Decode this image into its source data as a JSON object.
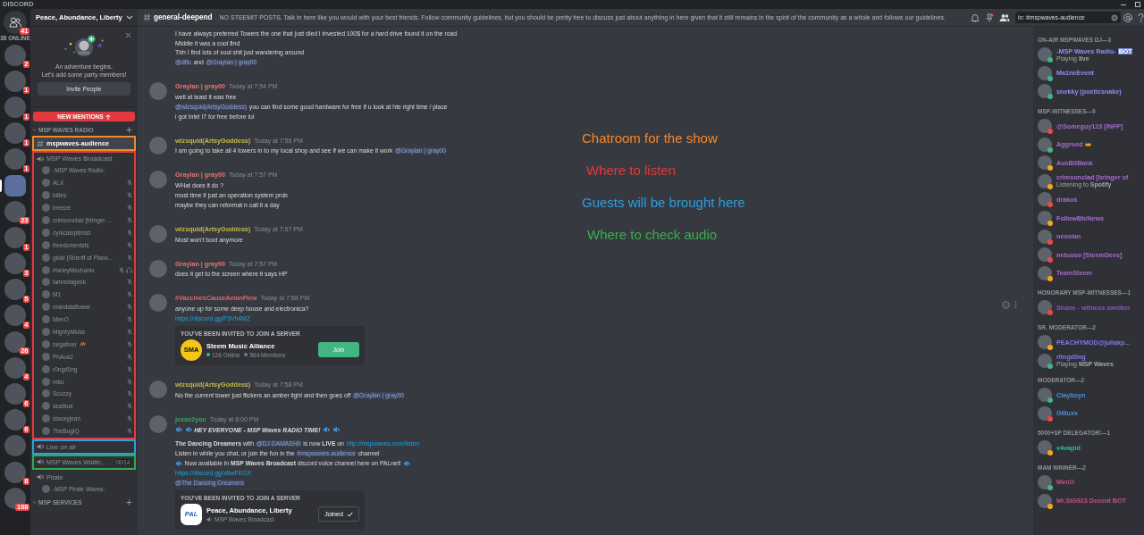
{
  "app_title": "DISCORD",
  "servers": {
    "friends_badge": "41",
    "online_count": "38 ONLINE",
    "items": [
      {
        "badge": "2",
        "selected": false
      },
      {
        "badge": "1",
        "selected": false
      },
      {
        "badge": "1",
        "selected": false
      },
      {
        "badge": "1",
        "selected": false
      },
      {
        "badge": "1",
        "selected": false
      },
      {
        "selected": true
      },
      {
        "badge": "23",
        "selected": false
      },
      {
        "badge": "1",
        "selected": false
      },
      {
        "badge": "3",
        "selected": false
      },
      {
        "badge": "5",
        "selected": false
      },
      {
        "badge": "4",
        "selected": false
      },
      {
        "badge": "26",
        "selected": false
      },
      {
        "badge": "4",
        "selected": false
      },
      {
        "badge": "6",
        "selected": false
      },
      {
        "badge": "6",
        "selected": false
      },
      {
        "selected": false
      },
      {
        "badge": "8",
        "selected": false
      },
      {
        "badge": "108",
        "selected": false
      }
    ]
  },
  "sidebar": {
    "server_name": "Peace, Abundance, Liberty",
    "welcome": {
      "title": "An adventure begins.",
      "subtitle": "Let's add some party members!",
      "button": "Invite People"
    },
    "new_mentions": "NEW MENTIONS",
    "categories": [
      {
        "name": "MSP WAVES RADIO",
        "channels": [
          {
            "kind": "text",
            "name": "mspwaves-audience",
            "selected": true,
            "color": "#f08a2c"
          },
          {
            "kind": "voice",
            "name": "MSP Waves Broadcast",
            "selected": false,
            "color": "#e33b3b",
            "users": [
              {
                "name": "-MSP Waves Radio-",
                "muted": false,
                "deafened": false,
                "emoji": false
              },
              {
                "name": "ALX",
                "muted": true,
                "deafened": false,
                "emoji": false
              },
              {
                "name": "bities",
                "muted": true,
                "deafened": false,
                "emoji": false
              },
              {
                "name": "breeze",
                "muted": true,
                "deafened": false,
                "emoji": false
              },
              {
                "name": "crimsonclad [bringer ...",
                "muted": true,
                "deafened": false,
                "emoji": false
              },
              {
                "name": "cynicaloptimist",
                "muted": true,
                "deafened": false,
                "emoji": false
              },
              {
                "name": "freedomexists",
                "muted": true,
                "deafened": false,
                "emoji": false
              },
              {
                "name": "globi (Sheriff of Plank...",
                "muted": true,
                "deafened": false,
                "emoji": false
              },
              {
                "name": "HarleyMechanix",
                "muted": true,
                "deafened": true,
                "emoji": false
              },
              {
                "name": "iamnotageek",
                "muted": true,
                "deafened": false,
                "emoji": false
              },
              {
                "name": "M1",
                "muted": true,
                "deafened": false,
                "emoji": false
              },
              {
                "name": "mandalaflower",
                "muted": true,
                "deafened": false,
                "emoji": false
              },
              {
                "name": "MenO",
                "muted": true,
                "deafened": false,
                "emoji": false
              },
              {
                "name": "MightyMicke",
                "muted": true,
                "deafened": false,
                "emoji": false
              },
              {
                "name": "negativer",
                "muted": true,
                "deafened": false,
                "emoji": true
              },
              {
                "name": "PhAus2",
                "muted": true,
                "deafened": false,
                "emoji": false
              },
              {
                "name": "r0ngd0ng",
                "muted": true,
                "deafened": false,
                "emoji": false
              },
              {
                "name": "reko",
                "muted": true,
                "deafened": false,
                "emoji": false
              },
              {
                "name": "Scuzzy",
                "muted": true,
                "deafened": false,
                "emoji": false
              },
              {
                "name": "seablue",
                "muted": true,
                "deafened": false,
                "emoji": false
              },
              {
                "name": "staceyjean",
                "muted": true,
                "deafened": false,
                "emoji": false
              },
              {
                "name": "TheBugIQ",
                "muted": true,
                "deafened": false,
                "emoji": false
              }
            ]
          },
          {
            "kind": "voice",
            "name": "Live on air",
            "selected": false,
            "color": "#2b9fe2"
          },
          {
            "kind": "voice",
            "name": "MSP Waves Waitin...",
            "limit": "00/14",
            "selected": false,
            "color": "#33aa4f"
          },
          {
            "kind": "voice",
            "name": "Pirate",
            "selected": false,
            "users": [
              {
                "name": "-MSP Pirate Waves-",
                "muted": false,
                "deafened": false,
                "emoji": false
              }
            ]
          }
        ]
      },
      {
        "name": "MSP SERVICES"
      }
    ]
  },
  "header": {
    "channel": "general-deepend",
    "topic": "NO STEEMIT POSTS. Talk in here like you would with your best friends. Follow community guidelines, but you should be pretty free to discuss just about anything in here given that it still remains in the spirit of the community as a whole and follows our guidelines.",
    "search_value": "in: #mspwaves-audience"
  },
  "messages": [
    {
      "show_actions": false,
      "paragraphs": [
        [
          [
            {
              "kind": "text",
              "text": "I have always preferred Towers the one that just died I invested 100$ for a hard drive found it on the road"
            }
          ],
          [
            {
              "kind": "text",
              "text": "Middle it was a cool find"
            }
          ],
          [
            {
              "kind": "text",
              "text": "Tbh I find lots of xool shit just wandering around"
            }
          ],
          [
            {
              "kind": "mention",
              "text": "@dflo"
            },
            {
              "kind": "text",
              "text": "and"
            },
            {
              "kind": "mention",
              "text": "@Graylan | gray00"
            }
          ]
        ]
      ]
    },
    {
      "author": "Graylan | gray00",
      "color": "#e8776b",
      "time": "Today at 7:54 PM",
      "show_actions": false,
      "paragraphs": [
        [
          [
            {
              "kind": "text",
              "text": "well at least it was free"
            }
          ],
          [
            {
              "kind": "mention",
              "text": "@wizsquid(ArtsyGoddess)"
            },
            {
              "kind": "text",
              "text": "you can find some good hardware for free if u look at hte right time / place"
            }
          ],
          [
            {
              "kind": "text",
              "text": "i got Intel I7 for free before lol"
            }
          ]
        ]
      ]
    },
    {
      "author": "wizsquid(ArtsyGoddess)",
      "color": "#c4b94a",
      "time": "Today at 7:56 PM",
      "show_actions": false,
      "paragraphs": [
        [
          [
            {
              "kind": "text",
              "text": "I am going to take all 4 towers in to my local shop and see if we can make it work"
            },
            {
              "kind": "mention",
              "text": "@Graylan | gray00"
            }
          ]
        ]
      ]
    },
    {
      "author": "Graylan | gray00",
      "color": "#e8776b",
      "time": "Today at 7:57 PM",
      "show_actions": false,
      "paragraphs": [
        [
          [
            {
              "kind": "text",
              "text": "WHat does it do ?"
            }
          ],
          [
            {
              "kind": "text",
              "text": "most time it just an operation system prob"
            }
          ],
          [
            {
              "kind": "text",
              "text": "maybe they can reformat n call it a day"
            }
          ]
        ]
      ]
    },
    {
      "author": "wizsquid(ArtsyGoddess)",
      "color": "#c4b94a",
      "time": "Today at 7:57 PM",
      "show_actions": false,
      "paragraphs": [
        [
          [
            {
              "kind": "text",
              "text": "Most won't boot anymore"
            }
          ]
        ]
      ]
    },
    {
      "author": "Graylan | gray00",
      "color": "#e8776b",
      "time": "Today at 7:57 PM",
      "show_actions": false,
      "paragraphs": [
        [
          [
            {
              "kind": "text",
              "text": "does it get to the screen where it says HP"
            }
          ]
        ]
      ]
    },
    {
      "author": "#VaccinesCauseAvianFlew",
      "color": "#e0656e",
      "time": "Today at 7:58 PM",
      "show_actions": true,
      "paragraphs": [
        [
          [
            {
              "kind": "text",
              "text": "anyone up for some deep house and electronica?"
            }
          ],
          [
            {
              "kind": "link",
              "text": "https://discord.gg/P3Vh4MZ"
            }
          ]
        ]
      ],
      "invite": {
        "heading": "YOU'VE BEEN INVITED TO JOIN A SERVER",
        "logo": "SMA",
        "server": "Steem Music Alliance",
        "online": "126 Online",
        "members": "564 Members",
        "button": "Join",
        "joined": false
      }
    },
    {
      "author": "wizsquid(ArtsyGoddess)",
      "color": "#c4b94a",
      "time": "Today at 7:58 PM",
      "show_actions": false,
      "paragraphs": [
        [
          [
            {
              "kind": "text",
              "text": "No the current tower just flickers an amber light and then goes off"
            },
            {
              "kind": "mention",
              "text": "@Graylan | gray00"
            }
          ]
        ]
      ]
    },
    {
      "author": "jesse2you",
      "color": "#3aa55d",
      "time": "Today at 8:00 PM",
      "show_actions": false,
      "paragraphs": [
        [
          [
            {
              "kind": "emoji"
            },
            {
              "kind": "emoji"
            },
            {
              "kind": "emphasis",
              "text": "HEY EVERYONE - MSP Waves RADIO TIME!"
            },
            {
              "kind": "emoji"
            },
            {
              "kind": "emoji"
            }
          ]
        ],
        [
          [
            {
              "kind": "text",
              "text": "**The Dancing Dreamers** with"
            },
            {
              "kind": "mention",
              "text": "@DJ DAMASHII"
            },
            {
              "kind": "text",
              "text": "is now **LIVE** on"
            },
            {
              "kind": "link",
              "text": "http://mspwaves.com/listen"
            }
          ],
          [
            {
              "kind": "text",
              "text": "Listen in while you chat, or join the fun in the"
            },
            {
              "kind": "channel",
              "text": "#mspwaves-audience"
            },
            {
              "kind": "text",
              "text": "channel"
            }
          ],
          [
            {
              "kind": "emoji"
            },
            {
              "kind": "text",
              "text": "Now available in **MSP Waves Broadcast** discord voice channel here on PALnet!"
            },
            {
              "kind": "emoji"
            }
          ],
          [
            {
              "kind": "link",
              "text": "https://discord.gg/xBwFKGX"
            }
          ],
          [
            {
              "kind": "mention",
              "text": "@The Dancing Dreamers"
            }
          ]
        ]
      ],
      "invite": {
        "heading": "YOU'VE BEEN INVITED TO JOIN A SERVER",
        "logo": "PAL",
        "server": "Peace, Abundance, Liberty",
        "channel": "MSP Waves Broadcast",
        "button": "Joined",
        "joined": true
      }
    }
  ],
  "annotations": [
    {
      "text": "Chatroom for the show",
      "color": "#f5872b"
    },
    {
      "text": "Where to listen",
      "color": "#e93838"
    },
    {
      "text": "Guests will be brought here",
      "color": "#2a9fe0"
    },
    {
      "text": "Where to check audio",
      "color": "#36b24a"
    }
  ],
  "members": {
    "groups": [
      {
        "title": "ON-AIR MSPWAVES DJ—3",
        "color": "#8e8ef5",
        "members": [
          {
            "name": "-MSP Waves Radio-",
            "color": "#43b581",
            "tag": "BOT",
            "activity": "Playing **live**",
            "crown": false
          },
          {
            "name": "Ma1neEvent",
            "color": "#43b581",
            "crown": false
          },
          {
            "name": "snekky (poeticsnake)",
            "color": "#43b581",
            "crown": false
          }
        ]
      },
      {
        "title": "MSP-WITNESSES—9",
        "color": "#a66bd0",
        "members": [
          {
            "name": "@Someguy123 [INFP]",
            "color": "#f04747",
            "crown": false
          },
          {
            "name": "Aggroed",
            "color": "#43b581",
            "crown": true
          },
          {
            "name": "AusBitBank",
            "color": "#faa61a",
            "crown": false
          },
          {
            "name": "crimsonclad [bringer of",
            "color": "#faa61a",
            "activity": "Listening to **Spotify**",
            "crown": false
          },
          {
            "name": "drakos",
            "color": "#f04747",
            "crown": false
          },
          {
            "name": "FollowBtcNews",
            "color": "#faa61a",
            "crown": false
          },
          {
            "name": "neoxian",
            "color": "#f04747",
            "crown": false
          },
          {
            "name": "netuoso [SteemDevs]",
            "color": "#f04747",
            "crown": false
          },
          {
            "name": "TeamSteem",
            "color": "#faa61a",
            "crown": false
          }
        ]
      },
      {
        "title": "HONORARY MSP-WITNESSES—1",
        "color": "#8a52c8",
        "members": [
          {
            "name": "Shane - witness swelker",
            "color": "#f04747",
            "crown": false
          }
        ]
      },
      {
        "title": "SR. MODERATOR—2",
        "color": "#8577f2",
        "members": [
          {
            "name": "PEACHYMOD@juliakp...",
            "color": "#faa61a",
            "crown": false
          },
          {
            "name": "r0ngd0ng",
            "color": "#43b581",
            "activity": "Playing **MSP Waves**",
            "crown": false
          }
        ]
      },
      {
        "title": "MODERATOR—2",
        "color": "#4a90d9",
        "members": [
          {
            "name": "Clayboyn",
            "color": "#43b581",
            "crown": false
          },
          {
            "name": "GMuxx",
            "color": "#f04747",
            "crown": false
          }
        ]
      },
      {
        "title": "5000+SP DELEGATOR!—1",
        "color": "#1fc1a3",
        "members": [
          {
            "name": "v4vapid",
            "color": "#faa61a",
            "crown": false
          }
        ]
      },
      {
        "title": "MAM WINNER—2",
        "color": "#c4508a",
        "members": [
          {
            "name": "MenO",
            "color": "#43b581",
            "crown": false
          },
          {
            "name": "Mr.SIG923 Decent BOT",
            "color": "#faa61a",
            "crown": false
          }
        ]
      }
    ]
  }
}
